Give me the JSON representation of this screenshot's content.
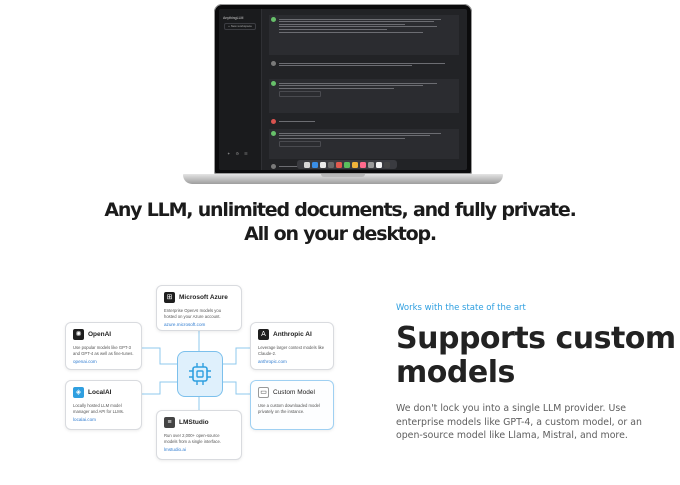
{
  "laptop": {
    "app_title": "AnythingLLM",
    "new_thread_label": "+ New workspace",
    "footer_icons": "✦ ⚙ ☰"
  },
  "headline": {
    "line1": "Any LLM, unlimited documents, and fully private.",
    "line2": "All on your desktop."
  },
  "diagram": {
    "cards": {
      "microsoft_azure": {
        "title": "Microsoft Azure",
        "description": "Enterprise OpenAI models you hosted on your Azure account.",
        "link": "azure.microsoft.com",
        "icon": "azure-icon"
      },
      "openai": {
        "title": "OpenAI",
        "description": "Use popular models like GPT-3 and GPT-4 as well as fine-tunes.",
        "link": "openai.com",
        "icon": "openai-icon"
      },
      "anthropic": {
        "title": "Anthropic AI",
        "description": "Leverage larger context models like Claude-2.",
        "link": "anthropic.com",
        "icon": "anthropic-icon"
      },
      "localai": {
        "title": "LocalAI",
        "description": "Locally hosted LLM model manager and API for LLMs.",
        "link": "localai.com",
        "icon": "localai-icon"
      },
      "custom_model": {
        "title": "Custom Model",
        "description": "Use a custom downloaded model privately on the instance.",
        "icon": "custom-model-icon"
      },
      "lmstudio": {
        "title": "LMStudio",
        "description": "Run over 2,000+ open-source models from a single interface.",
        "link": "lmstudio.ai",
        "icon": "lmstudio-icon"
      }
    },
    "colors": {
      "hub_fill": "#dff0fc",
      "hub_border": "#7cc0ec",
      "wire": "#8fc9ee"
    }
  },
  "feature": {
    "eyebrow": "Works with the state of the art",
    "title": "Supports custom models",
    "body": "We don't lock you into a single LLM provider. Use enterprise models like GPT-4, a custom model, or an open-source model like Llama, Mistral, and more."
  },
  "colors": {
    "accent": "#2f9fe0",
    "headline": "#1b1b1b",
    "body": "#5e5e5e"
  }
}
